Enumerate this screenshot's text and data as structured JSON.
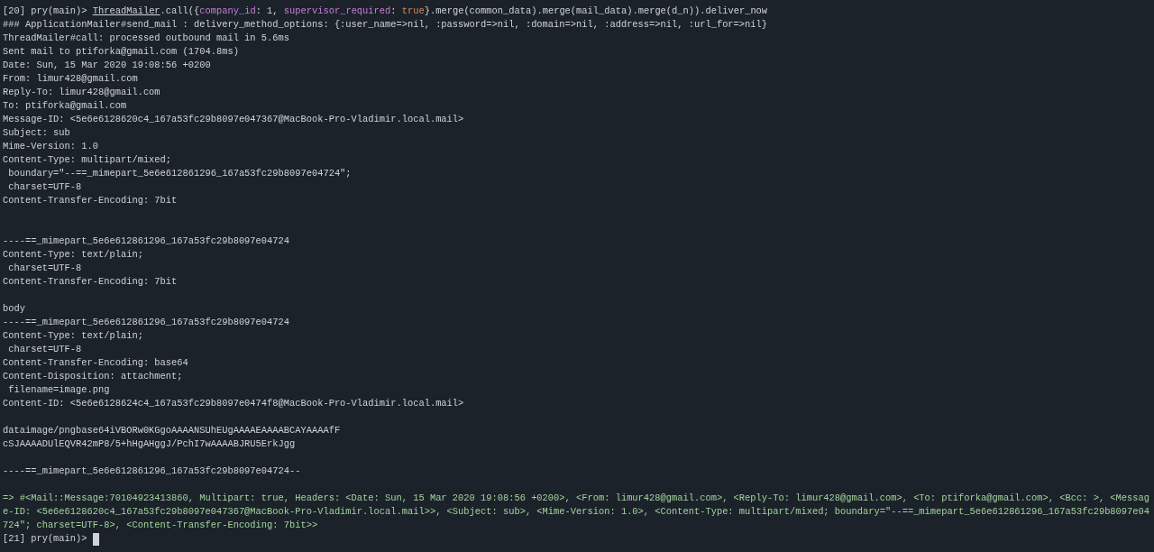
{
  "terminal": {
    "lines": [
      {
        "kind": "command",
        "prompt": "[20] pry(main)>",
        "segments": [
          {
            "kind": "const",
            "text": "ThreadMailer"
          },
          {
            "kind": "plain",
            "text": ".call({"
          },
          {
            "kind": "key",
            "text": "company_id"
          },
          {
            "kind": "plain",
            "text": ": 1, "
          },
          {
            "kind": "key",
            "text": "supervisor_required"
          },
          {
            "kind": "plain",
            "text": ": "
          },
          {
            "kind": "literal",
            "text": "true"
          },
          {
            "kind": "plain",
            "text": "}.merge(common_data).merge(mail_data).merge(d_n)).deliver_now"
          }
        ]
      },
      {
        "kind": "output",
        "text": "### ApplicationMailer#send_mail : delivery_method_options: {:user_name=>nil, :password=>nil, :domain=>nil, :address=>nil, :url_for=>nil}"
      },
      {
        "kind": "output",
        "text": "ThreadMailer#call: processed outbound mail in 5.6ms"
      },
      {
        "kind": "output",
        "text": "Sent mail to ptiforka@gmail.com (1704.8ms)"
      },
      {
        "kind": "output",
        "text": "Date: Sun, 15 Mar 2020 19:08:56 +0200"
      },
      {
        "kind": "output",
        "text": "From: limur428@gmail.com"
      },
      {
        "kind": "output",
        "text": "Reply-To: limur428@gmail.com"
      },
      {
        "kind": "output",
        "text": "To: ptiforka@gmail.com"
      },
      {
        "kind": "output",
        "text": "Message-ID: <5e6e6128620c4_167a53fc29b8097e047367@MacBook-Pro-Vladimir.local.mail>"
      },
      {
        "kind": "output",
        "text": "Subject: sub"
      },
      {
        "kind": "output",
        "text": "Mime-Version: 1.0"
      },
      {
        "kind": "output",
        "text": "Content-Type: multipart/mixed;"
      },
      {
        "kind": "output",
        "text": " boundary=\"--==_mimepart_5e6e612861296_167a53fc29b8097e04724\";"
      },
      {
        "kind": "output",
        "text": " charset=UTF-8"
      },
      {
        "kind": "output",
        "text": "Content-Transfer-Encoding: 7bit"
      },
      {
        "kind": "blank"
      },
      {
        "kind": "blank"
      },
      {
        "kind": "output",
        "text": "----==_mimepart_5e6e612861296_167a53fc29b8097e04724"
      },
      {
        "kind": "output",
        "text": "Content-Type: text/plain;"
      },
      {
        "kind": "output",
        "text": " charset=UTF-8"
      },
      {
        "kind": "output",
        "text": "Content-Transfer-Encoding: 7bit"
      },
      {
        "kind": "blank"
      },
      {
        "kind": "output",
        "text": "body"
      },
      {
        "kind": "output",
        "text": "----==_mimepart_5e6e612861296_167a53fc29b8097e04724"
      },
      {
        "kind": "output",
        "text": "Content-Type: text/plain;"
      },
      {
        "kind": "output",
        "text": " charset=UTF-8"
      },
      {
        "kind": "output",
        "text": "Content-Transfer-Encoding: base64"
      },
      {
        "kind": "output",
        "text": "Content-Disposition: attachment;"
      },
      {
        "kind": "output",
        "text": " filename=image.png"
      },
      {
        "kind": "output",
        "text": "Content-ID: <5e6e6128624c4_167a53fc29b8097e0474f8@MacBook-Pro-Vladimir.local.mail>"
      },
      {
        "kind": "blank"
      },
      {
        "kind": "output",
        "text": "dataimage/pngbase64iVBORw0KGgoAAAANSUhEUgAAAAEAAAABCAYAAAAfF"
      },
      {
        "kind": "output",
        "text": "cSJAAAADUlEQVR42mP8/5+hHgAHggJ/PchI7wAAAABJRU5ErkJgg"
      },
      {
        "kind": "blank"
      },
      {
        "kind": "output",
        "text": "----==_mimepart_5e6e612861296_167a53fc29b8097e04724--"
      },
      {
        "kind": "blank"
      },
      {
        "kind": "result",
        "text": "=> #<Mail::Message:70104923413860, Multipart: true, Headers: <Date: Sun, 15 Mar 2020 19:08:56 +0200>, <From: limur428@gmail.com>, <Reply-To: limur428@gmail.com>, <To: ptiforka@gmail.com>, <Bcc: >, <Message-ID: <5e6e6128620c4_167a53fc29b8097e047367@MacBook-Pro-Vladimir.local.mail>>, <Subject: sub>, <Mime-Version: 1.0>, <Content-Type: multipart/mixed; boundary=\"--==_mimepart_5e6e612861296_167a53fc29b8097e04724\"; charset=UTF-8>, <Content-Transfer-Encoding: 7bit>>"
      },
      {
        "kind": "prompt",
        "prompt": "[21] pry(main)>"
      }
    ]
  }
}
